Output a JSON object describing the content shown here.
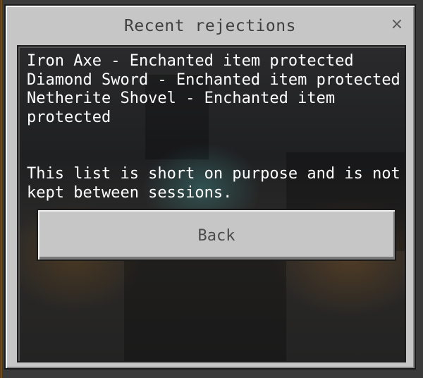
{
  "dialog": {
    "title": "Recent rejections",
    "close_label": "×",
    "messages": [
      "Iron Axe - Enchanted item protected",
      "Diamond Sword - Enchanted item protected",
      "Netherite Shovel - Enchanted item protected"
    ],
    "note": "This list is short on purpose and is not kept between sessions.",
    "back_label": "Back"
  },
  "colors": {
    "dialog_background": "#c6c6c6",
    "panel_background": "#1f2022",
    "text_light": "#ffffff",
    "text_dark": "#3f3f3f"
  }
}
